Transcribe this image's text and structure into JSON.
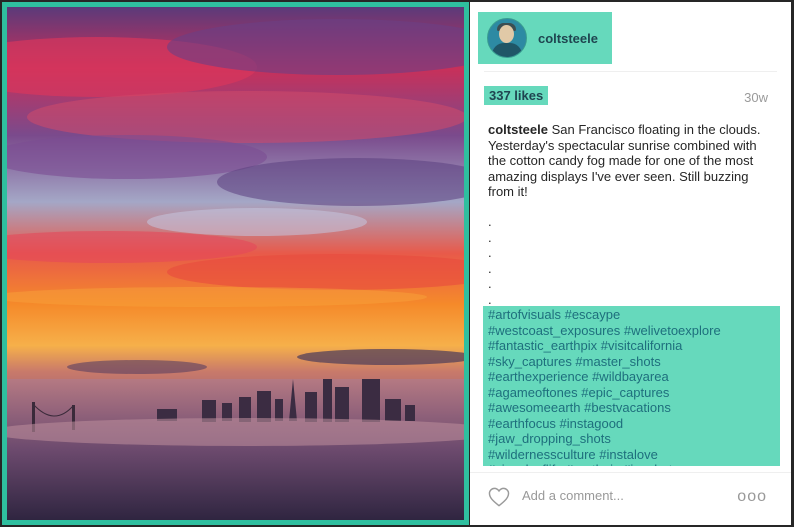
{
  "post": {
    "username": "coltsteele",
    "likes": "337 likes",
    "time": "30w",
    "caption_user": "coltsteele",
    "caption_text": "San Francisco floating in the clouds. Yesterday's spectacular sunrise combined with the cotton candy fog made for one of the most amazing displays I've ever seen. Still buzzing from it!",
    "dots": ".\n.\n.\n.\n.\n.",
    "hashtags": "#artofvisuals #escaype\n#westcoast_exposures #welivetoexplore\n#fantastic_earthpix #visitcalifornia\n#sky_captures #master_shots\n#earthexperience #wildbayarea\n#agameoftones #epic_captures\n#awesomeearth #bestvacations\n#earthfocus #instagood\n#jaw_dropping_shots\n#wildernessculture #instalove\n#visualsoflife #earthpix #ig_shots"
  },
  "comment": {
    "placeholder": "Add a comment...",
    "more_label": "ooo"
  },
  "icons": {
    "like": "heart-icon",
    "options": "more-options-icon"
  },
  "colors": {
    "accent": "#66d9bc",
    "frame_border": "#2fbf9f"
  }
}
